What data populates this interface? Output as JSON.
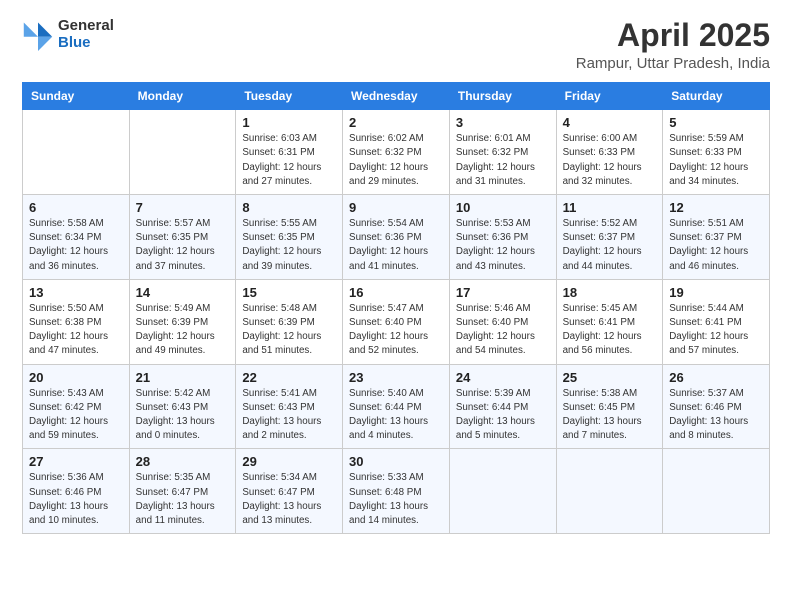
{
  "logo": {
    "general": "General",
    "blue": "Blue"
  },
  "title": "April 2025",
  "location": "Rampur, Uttar Pradesh, India",
  "days_of_week": [
    "Sunday",
    "Monday",
    "Tuesday",
    "Wednesday",
    "Thursday",
    "Friday",
    "Saturday"
  ],
  "weeks": [
    [
      {
        "day": "",
        "info": ""
      },
      {
        "day": "",
        "info": ""
      },
      {
        "day": "1",
        "info": "Sunrise: 6:03 AM\nSunset: 6:31 PM\nDaylight: 12 hours and 27 minutes."
      },
      {
        "day": "2",
        "info": "Sunrise: 6:02 AM\nSunset: 6:32 PM\nDaylight: 12 hours and 29 minutes."
      },
      {
        "day": "3",
        "info": "Sunrise: 6:01 AM\nSunset: 6:32 PM\nDaylight: 12 hours and 31 minutes."
      },
      {
        "day": "4",
        "info": "Sunrise: 6:00 AM\nSunset: 6:33 PM\nDaylight: 12 hours and 32 minutes."
      },
      {
        "day": "5",
        "info": "Sunrise: 5:59 AM\nSunset: 6:33 PM\nDaylight: 12 hours and 34 minutes."
      }
    ],
    [
      {
        "day": "6",
        "info": "Sunrise: 5:58 AM\nSunset: 6:34 PM\nDaylight: 12 hours and 36 minutes."
      },
      {
        "day": "7",
        "info": "Sunrise: 5:57 AM\nSunset: 6:35 PM\nDaylight: 12 hours and 37 minutes."
      },
      {
        "day": "8",
        "info": "Sunrise: 5:55 AM\nSunset: 6:35 PM\nDaylight: 12 hours and 39 minutes."
      },
      {
        "day": "9",
        "info": "Sunrise: 5:54 AM\nSunset: 6:36 PM\nDaylight: 12 hours and 41 minutes."
      },
      {
        "day": "10",
        "info": "Sunrise: 5:53 AM\nSunset: 6:36 PM\nDaylight: 12 hours and 43 minutes."
      },
      {
        "day": "11",
        "info": "Sunrise: 5:52 AM\nSunset: 6:37 PM\nDaylight: 12 hours and 44 minutes."
      },
      {
        "day": "12",
        "info": "Sunrise: 5:51 AM\nSunset: 6:37 PM\nDaylight: 12 hours and 46 minutes."
      }
    ],
    [
      {
        "day": "13",
        "info": "Sunrise: 5:50 AM\nSunset: 6:38 PM\nDaylight: 12 hours and 47 minutes."
      },
      {
        "day": "14",
        "info": "Sunrise: 5:49 AM\nSunset: 6:39 PM\nDaylight: 12 hours and 49 minutes."
      },
      {
        "day": "15",
        "info": "Sunrise: 5:48 AM\nSunset: 6:39 PM\nDaylight: 12 hours and 51 minutes."
      },
      {
        "day": "16",
        "info": "Sunrise: 5:47 AM\nSunset: 6:40 PM\nDaylight: 12 hours and 52 minutes."
      },
      {
        "day": "17",
        "info": "Sunrise: 5:46 AM\nSunset: 6:40 PM\nDaylight: 12 hours and 54 minutes."
      },
      {
        "day": "18",
        "info": "Sunrise: 5:45 AM\nSunset: 6:41 PM\nDaylight: 12 hours and 56 minutes."
      },
      {
        "day": "19",
        "info": "Sunrise: 5:44 AM\nSunset: 6:41 PM\nDaylight: 12 hours and 57 minutes."
      }
    ],
    [
      {
        "day": "20",
        "info": "Sunrise: 5:43 AM\nSunset: 6:42 PM\nDaylight: 12 hours and 59 minutes."
      },
      {
        "day": "21",
        "info": "Sunrise: 5:42 AM\nSunset: 6:43 PM\nDaylight: 13 hours and 0 minutes."
      },
      {
        "day": "22",
        "info": "Sunrise: 5:41 AM\nSunset: 6:43 PM\nDaylight: 13 hours and 2 minutes."
      },
      {
        "day": "23",
        "info": "Sunrise: 5:40 AM\nSunset: 6:44 PM\nDaylight: 13 hours and 4 minutes."
      },
      {
        "day": "24",
        "info": "Sunrise: 5:39 AM\nSunset: 6:44 PM\nDaylight: 13 hours and 5 minutes."
      },
      {
        "day": "25",
        "info": "Sunrise: 5:38 AM\nSunset: 6:45 PM\nDaylight: 13 hours and 7 minutes."
      },
      {
        "day": "26",
        "info": "Sunrise: 5:37 AM\nSunset: 6:46 PM\nDaylight: 13 hours and 8 minutes."
      }
    ],
    [
      {
        "day": "27",
        "info": "Sunrise: 5:36 AM\nSunset: 6:46 PM\nDaylight: 13 hours and 10 minutes."
      },
      {
        "day": "28",
        "info": "Sunrise: 5:35 AM\nSunset: 6:47 PM\nDaylight: 13 hours and 11 minutes."
      },
      {
        "day": "29",
        "info": "Sunrise: 5:34 AM\nSunset: 6:47 PM\nDaylight: 13 hours and 13 minutes."
      },
      {
        "day": "30",
        "info": "Sunrise: 5:33 AM\nSunset: 6:48 PM\nDaylight: 13 hours and 14 minutes."
      },
      {
        "day": "",
        "info": ""
      },
      {
        "day": "",
        "info": ""
      },
      {
        "day": "",
        "info": ""
      }
    ]
  ]
}
